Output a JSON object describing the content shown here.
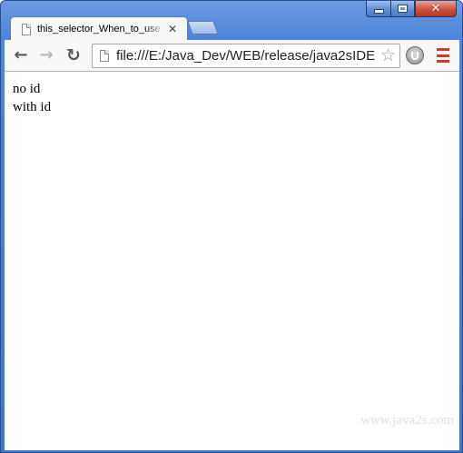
{
  "window": {
    "minimize_icon": "minimize-icon",
    "maximize_icon": "maximize-icon",
    "close_glyph": "✕",
    "frame_color": "#4f86d9",
    "close_color": "#c9503a"
  },
  "tab": {
    "title": "this_selector_When_to_use",
    "close_glyph": "✕",
    "icon": "page-icon"
  },
  "toolbar": {
    "back_glyph": "←",
    "forward_glyph": "→",
    "reload_glyph": "↻",
    "url": "file:///E:/Java_Dev/WEB/release/java2sIDE",
    "star_glyph": "☆",
    "extension_icon": "extension-icon",
    "menu_icon": "menu-icon",
    "menu_color": "#d03a2b"
  },
  "page": {
    "lines": [
      "no id",
      "with id"
    ],
    "watermark": "www.java2s.com"
  }
}
